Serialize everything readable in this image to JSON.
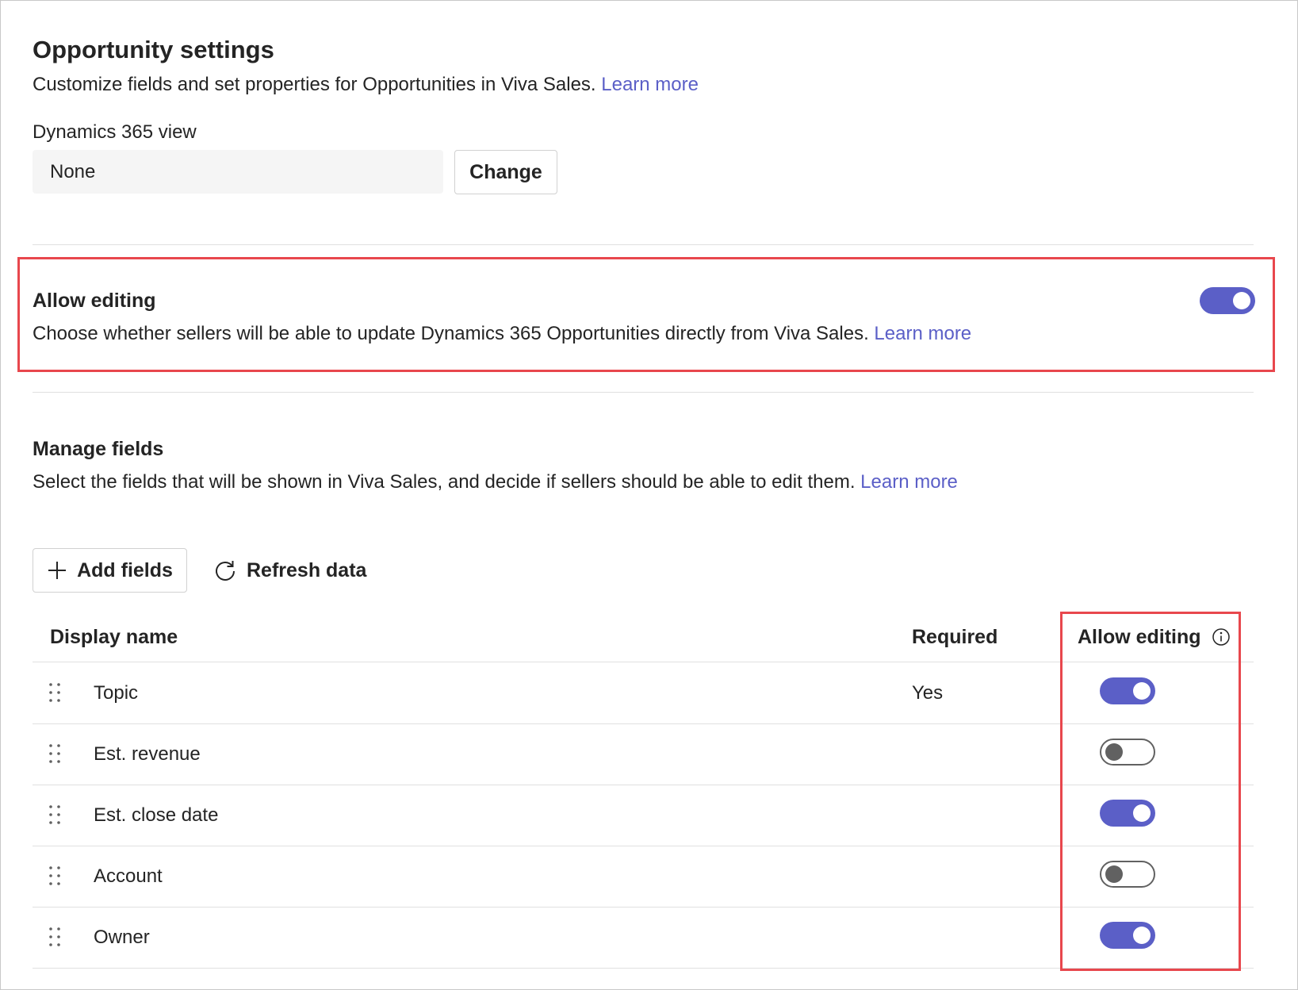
{
  "header": {
    "title": "Opportunity settings",
    "description": "Customize fields and set properties for Opportunities in Viva Sales.",
    "learn_more": "Learn more"
  },
  "dynamics_view": {
    "label": "Dynamics 365 view",
    "value": "None",
    "change_label": "Change"
  },
  "allow_editing": {
    "title": "Allow editing",
    "description": "Choose whether sellers will be able to update Dynamics 365 Opportunities directly from Viva Sales.",
    "learn_more": "Learn more",
    "enabled": true
  },
  "manage_fields": {
    "title": "Manage fields",
    "description": "Select the fields that will be shown in Viva Sales, and decide if sellers should be able to edit them.",
    "learn_more": "Learn more",
    "add_fields_label": "Add fields",
    "refresh_label": "Refresh data"
  },
  "table": {
    "columns": {
      "display_name": "Display name",
      "required": "Required",
      "allow_editing": "Allow editing"
    },
    "rows": [
      {
        "name": "Topic",
        "required": "Yes",
        "allow_editing": true
      },
      {
        "name": "Est. revenue",
        "required": "",
        "allow_editing": false
      },
      {
        "name": "Est. close date",
        "required": "",
        "allow_editing": true
      },
      {
        "name": "Account",
        "required": "",
        "allow_editing": false
      },
      {
        "name": "Owner",
        "required": "",
        "allow_editing": true
      }
    ]
  },
  "colors": {
    "accent": "#5b5fc7",
    "highlight": "#e8474d"
  }
}
